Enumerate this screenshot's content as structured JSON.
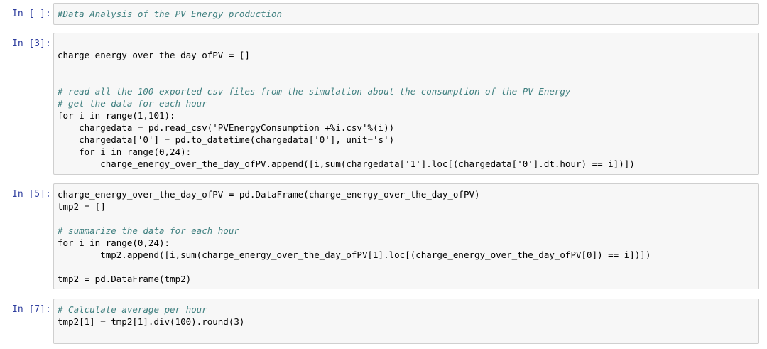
{
  "cells": [
    {
      "prompt": "In [ ]:",
      "lines": [
        "#Data Analysis of the PV Energy production"
      ]
    },
    {
      "prompt": "In [3]:",
      "lines": [
        "charge_energy_over_the_day_ofPV = []",
        "",
        "",
        "# read all the 100 exported csv files from the simulation about the consumption of the PV Energy",
        "# get the data for each hour",
        "for i in range(1,101):",
        "    chargedata = pd.read_csv('PVEnergyConsumption +%i.csv'%(i))",
        "    chargedata['0'] = pd.to_datetime(chargedata['0'], unit='s')",
        "    for i in range(0,24):",
        "        charge_energy_over_the_day_ofPV.append([i,sum(chargedata['1'].loc[(chargedata['0'].dt.hour) == i])])"
      ]
    },
    {
      "prompt": "In [5]:",
      "lines": [
        "charge_energy_over_the_day_ofPV = pd.DataFrame(charge_energy_over_the_day_ofPV)",
        "tmp2 = []",
        "",
        "# summarize the data for each hour",
        "for i in range(0,24):",
        "        tmp2.append([i,sum(charge_energy_over_the_day_ofPV[1].loc[(charge_energy_over_the_day_ofPV[0]) == i])])",
        "",
        "tmp2 = pd.DataFrame(tmp2)"
      ]
    },
    {
      "prompt": "In [7]:",
      "lines": [
        "# Calculate average per hour",
        "tmp2[1] = tmp2[1].div(100).round(3)"
      ]
    }
  ]
}
